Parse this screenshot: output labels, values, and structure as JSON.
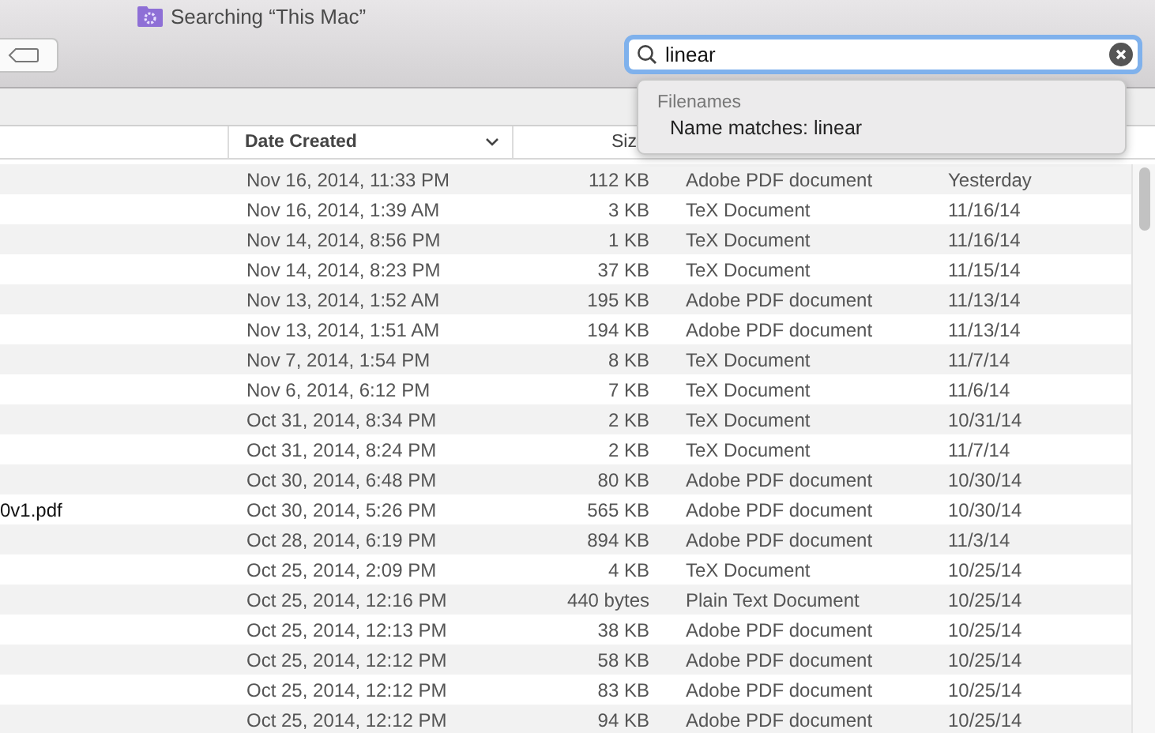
{
  "window": {
    "title": "Searching “This Mac”"
  },
  "search": {
    "value": "linear"
  },
  "suggestions": {
    "heading": "Filenames",
    "items": [
      {
        "label": "Name matches: linear"
      }
    ]
  },
  "table": {
    "columns": [
      {
        "label": "Date Created",
        "sorted": true
      },
      {
        "label": "Siz",
        "sorted": false
      }
    ],
    "rows": [
      {
        "date_created": "Nov 16, 2014, 11:33 PM",
        "size": "112 KB",
        "kind": "Adobe PDF document",
        "column_4": "Yesterday"
      },
      {
        "date_created": "Nov 16, 2014, 1:39 AM",
        "size": "3 KB",
        "kind": "TeX Document",
        "column_4": "11/16/14"
      },
      {
        "date_created": "Nov 14, 2014, 8:56 PM",
        "size": "1 KB",
        "kind": "TeX Document",
        "column_4": "11/16/14"
      },
      {
        "date_created": "Nov 14, 2014, 8:23 PM",
        "size": "37 KB",
        "kind": "TeX Document",
        "column_4": "11/15/14"
      },
      {
        "date_created": "Nov 13, 2014, 1:52 AM",
        "size": "195 KB",
        "kind": "Adobe PDF document",
        "column_4": "11/13/14"
      },
      {
        "date_created": "Nov 13, 2014, 1:51 AM",
        "size": "194 KB",
        "kind": "Adobe PDF document",
        "column_4": "11/13/14"
      },
      {
        "date_created": "Nov 7, 2014, 1:54 PM",
        "size": "8 KB",
        "kind": "TeX Document",
        "column_4": "11/7/14"
      },
      {
        "date_created": "Nov 6, 2014, 6:12 PM",
        "size": "7 KB",
        "kind": "TeX Document",
        "column_4": "11/6/14"
      },
      {
        "date_created": "Oct 31, 2014, 8:34 PM",
        "size": "2 KB",
        "kind": "TeX Document",
        "column_4": "10/31/14"
      },
      {
        "date_created": "Oct 31, 2014, 8:24 PM",
        "size": "2 KB",
        "kind": "TeX Document",
        "column_4": "11/7/14"
      },
      {
        "date_created": "Oct 30, 2014, 6:48 PM",
        "size": "80 KB",
        "kind": "Adobe PDF document",
        "column_4": "10/30/14"
      },
      {
        "name": "0v1.pdf",
        "date_created": "Oct 30, 2014, 5:26 PM",
        "size": "565 KB",
        "kind": "Adobe PDF document",
        "column_4": "10/30/14"
      },
      {
        "date_created": "Oct 28, 2014, 6:19 PM",
        "size": "894 KB",
        "kind": "Adobe PDF document",
        "column_4": "11/3/14"
      },
      {
        "date_created": "Oct 25, 2014, 2:09 PM",
        "size": "4 KB",
        "kind": "TeX Document",
        "column_4": "10/25/14"
      },
      {
        "date_created": "Oct 25, 2014, 12:16 PM",
        "size": "440 bytes",
        "kind": "Plain Text Document",
        "column_4": "10/25/14"
      },
      {
        "date_created": "Oct 25, 2014, 12:13 PM",
        "size": "38 KB",
        "kind": "Adobe PDF document",
        "column_4": "10/25/14"
      },
      {
        "date_created": "Oct 25, 2014, 12:12 PM",
        "size": "58 KB",
        "kind": "Adobe PDF document",
        "column_4": "10/25/14"
      },
      {
        "date_created": "Oct 25, 2014, 12:12 PM",
        "size": "83 KB",
        "kind": "Adobe PDF document",
        "column_4": "10/25/14"
      },
      {
        "date_created": "Oct 25, 2014, 12:12 PM",
        "size": "94 KB",
        "kind": "Adobe PDF document",
        "column_4": "10/25/14"
      }
    ]
  }
}
